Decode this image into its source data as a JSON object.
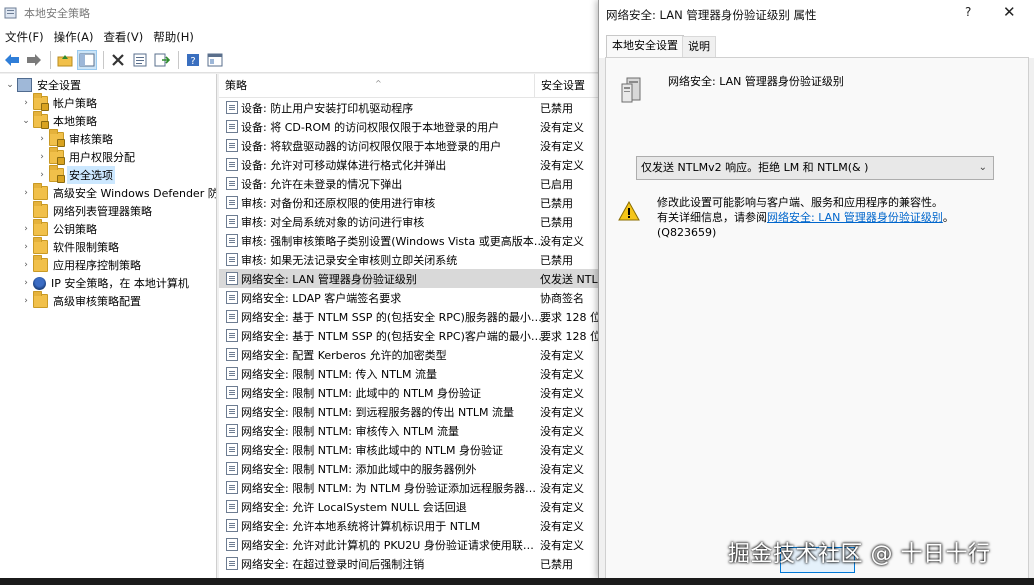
{
  "window": {
    "title": "本地安全策略",
    "menu": [
      "文件(F)",
      "操作(A)",
      "查看(V)",
      "帮助(H)"
    ],
    "toolbar": [
      "back-icon",
      "forward-icon",
      "up-folder-icon",
      "show-tree-icon",
      "delete-icon",
      "properties-icon",
      "export-icon",
      "help-icon",
      "console-icon"
    ]
  },
  "tree": [
    {
      "label": "安全设置",
      "level": 0,
      "exp": "⌄",
      "icon": "shield"
    },
    {
      "label": "帐户策略",
      "level": 1,
      "exp": "›",
      "icon": "lockfolder"
    },
    {
      "label": "本地策略",
      "level": 1,
      "exp": "⌄",
      "icon": "lockfolder"
    },
    {
      "label": "审核策略",
      "level": 2,
      "exp": "›",
      "icon": "lockfolder"
    },
    {
      "label": "用户权限分配",
      "level": 2,
      "exp": "›",
      "icon": "lockfolder"
    },
    {
      "label": "安全选项",
      "level": 2,
      "exp": "›",
      "icon": "lockfolder",
      "selected": true
    },
    {
      "label": "高级安全 Windows Defender 防火墙",
      "level": 1,
      "exp": "›",
      "icon": "folder"
    },
    {
      "label": "网络列表管理器策略",
      "level": 1,
      "exp": "",
      "icon": "folder"
    },
    {
      "label": "公钥策略",
      "level": 1,
      "exp": "›",
      "icon": "folder"
    },
    {
      "label": "软件限制策略",
      "level": 1,
      "exp": "›",
      "icon": "folder"
    },
    {
      "label": "应用程序控制策略",
      "level": 1,
      "exp": "›",
      "icon": "folder"
    },
    {
      "label": "IP 安全策略，在 本地计算机",
      "level": 1,
      "exp": "›",
      "icon": "ipsec"
    },
    {
      "label": "高级审核策略配置",
      "level": 1,
      "exp": "›",
      "icon": "folder"
    }
  ],
  "list": {
    "headers": [
      "策略",
      "安全设置"
    ],
    "rows": [
      {
        "name": "设备: 防止用户安装打印机驱动程序",
        "value": "已禁用"
      },
      {
        "name": "设备: 将 CD-ROM 的访问权限仅限于本地登录的用户",
        "value": "没有定义"
      },
      {
        "name": "设备: 将软盘驱动器的访问权限仅限于本地登录的用户",
        "value": "没有定义"
      },
      {
        "name": "设备: 允许对可移动媒体进行格式化并弹出",
        "value": "没有定义"
      },
      {
        "name": "设备: 允许在未登录的情况下弹出",
        "value": "已启用"
      },
      {
        "name": "审核: 对备份和还原权限的使用进行审核",
        "value": "已禁用"
      },
      {
        "name": "审核: 对全局系统对象的访问进行审核",
        "value": "已禁用"
      },
      {
        "name": "审核: 强制审核策略子类别设置(Windows Vista 或更高版本…",
        "value": "没有定义"
      },
      {
        "name": "审核: 如果无法记录安全审核则立即关闭系统",
        "value": "已禁用"
      },
      {
        "name": "网络安全: LAN 管理器身份验证级别",
        "value": "仅发送 NTLM",
        "selected": true
      },
      {
        "name": "网络安全: LDAP 客户端签名要求",
        "value": "协商签名"
      },
      {
        "name": "网络安全: 基于 NTLM SSP 的(包括安全 RPC)服务器的最小…",
        "value": "要求 128 位"
      },
      {
        "name": "网络安全: 基于 NTLM SSP 的(包括安全 RPC)客户端的最小…",
        "value": "要求 128 位"
      },
      {
        "name": "网络安全: 配置 Kerberos 允许的加密类型",
        "value": "没有定义"
      },
      {
        "name": "网络安全: 限制 NTLM: 传入 NTLM 流量",
        "value": "没有定义"
      },
      {
        "name": "网络安全: 限制 NTLM: 此域中的 NTLM 身份验证",
        "value": "没有定义"
      },
      {
        "name": "网络安全: 限制 NTLM: 到远程服务器的传出 NTLM 流量",
        "value": "没有定义"
      },
      {
        "name": "网络安全: 限制 NTLM: 审核传入 NTLM 流量",
        "value": "没有定义"
      },
      {
        "name": "网络安全: 限制 NTLM: 审核此域中的 NTLM 身份验证",
        "value": "没有定义"
      },
      {
        "name": "网络安全: 限制 NTLM: 添加此域中的服务器例外",
        "value": "没有定义"
      },
      {
        "name": "网络安全: 限制 NTLM: 为 NTLM 身份验证添加远程服务器…",
        "value": "没有定义"
      },
      {
        "name": "网络安全: 允许 LocalSystem NULL 会话回退",
        "value": "没有定义"
      },
      {
        "name": "网络安全: 允许本地系统将计算机标识用于 NTLM",
        "value": "没有定义"
      },
      {
        "name": "网络安全: 允许对此计算机的 PKU2U 身份验证请求使用联…",
        "value": "没有定义"
      },
      {
        "name": "网络安全: 在超过登录时间后强制注销",
        "value": "已禁用"
      }
    ]
  },
  "dialog": {
    "title": "网络安全: LAN 管理器身份验证级别 属性",
    "help": "?",
    "close": "✕",
    "tabs": [
      "本地安全设置",
      "说明"
    ],
    "policy_title": "网络安全: LAN 管理器身份验证级别",
    "selected_value": "仅发送 NTLMv2 响应。拒绝 LM 和 NTLM(& )",
    "warning_line1": "修改此设置可能影响与客户端、服务和应用程序的兼容性。",
    "warning_line2_prefix": "有关详细信息，请参阅",
    "warning_link": "网络安全: LAN 管理器身份验证级别",
    "warning_line2_suffix": "。",
    "warning_line3": "(Q823659)"
  },
  "watermark": "掘金技术社区 @ 十日十行"
}
